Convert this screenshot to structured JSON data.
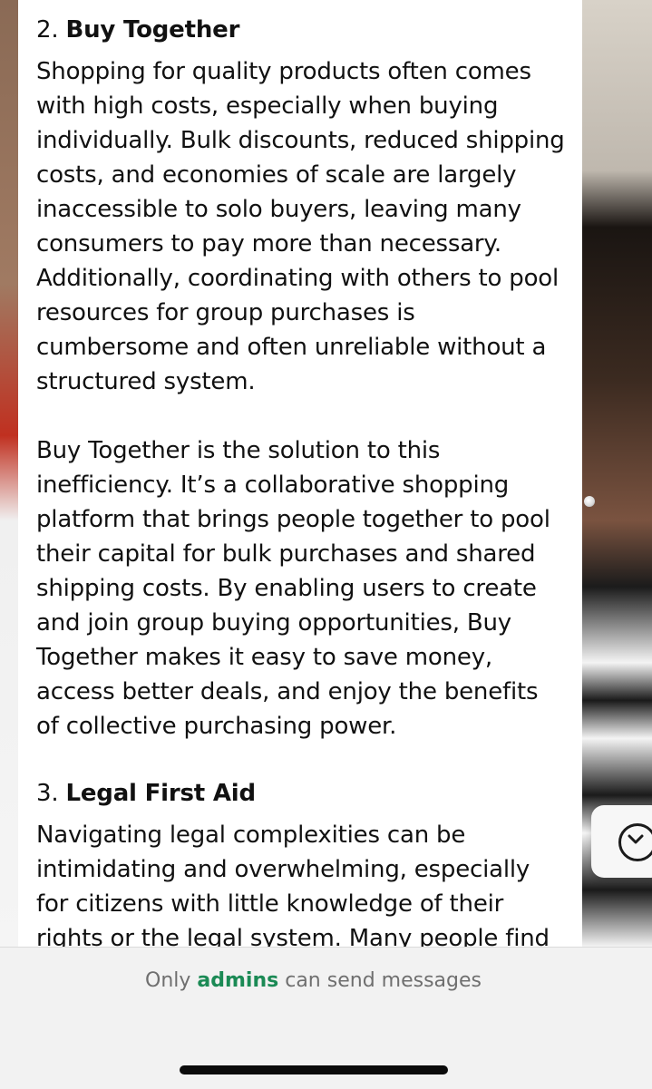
{
  "message": {
    "section2": {
      "number": "2.",
      "title": "Buy Together",
      "paragraph1": "Shopping for quality products often comes with high costs, especially when buying individually. Bulk discounts, reduced shipping costs, and economies of scale are largely inaccessible to solo buyers, leaving many consumers to pay more than necessary. Additionally, coordinating with others to pool resources for group purchases is cumbersome and often unreliable without a structured system.",
      "paragraph2": "Buy Together is the solution to this inefficiency. It’s a collaborative shopping platform that brings people together to pool their capital for bulk purchases and shared shipping costs. By enabling users to create and join group buying opportunities, Buy Together makes it easy to save money, access better deals, and enjoy the benefits of collective purchasing power."
    },
    "section3": {
      "number": "3.",
      "title": "Legal First Aid",
      "paragraph1": "Navigating legal complexities can be intimidating and overwhelming, especially for citizens with little knowledge of their rights or the legal system. Many people find them"
    }
  },
  "footer": {
    "note_prefix": "Only",
    "note_accent": "admins",
    "note_suffix": "can send messages",
    "accent_color": "#1b8a55"
  },
  "icons": {
    "scroll_down": "chevron-down-circle-icon"
  }
}
